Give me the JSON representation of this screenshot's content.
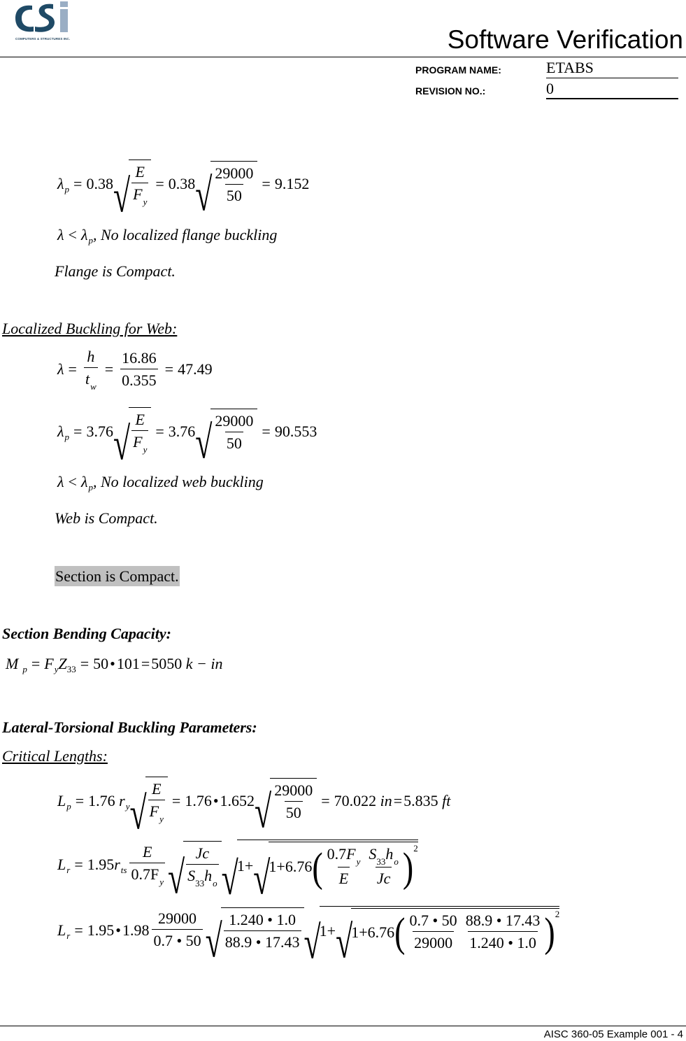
{
  "header": {
    "logo_text": "CSI",
    "logo_subtitle": "COMPUTERS & STRUCTURES INC.",
    "title": "Software Verification",
    "program_name_label": "PROGRAM NAME:",
    "program_name_value": "ETABS",
    "revision_label": "REVISION NO.:",
    "revision_value": "0",
    "colors": {
      "logo_dark": "#1f4a66",
      "logo_light": "#9aaec4"
    }
  },
  "flange": {
    "lambda_p": {
      "lhs": "λ",
      "lhs_sub": "p",
      "coef": "0.38",
      "num_sym": "E",
      "den_sym": "F",
      "den_sub": "y",
      "num_val": "29000",
      "den_val": "50",
      "result": "9.152"
    },
    "check": {
      "text": ", No localized flange buckling"
    },
    "conclusion": "Flange is Compact."
  },
  "web": {
    "heading": "Localized Buckling for Web:",
    "lambda": {
      "lhs": "λ",
      "num_sym": "h",
      "den_sym": "t",
      "den_sub": "w",
      "num_val": "16.86",
      "den_val": "0.355",
      "result": "47.49"
    },
    "lambda_p": {
      "lhs": "λ",
      "lhs_sub": "p",
      "coef": "3.76",
      "num_sym": "E",
      "den_sym": "F",
      "den_sub": "y",
      "num_val": "29000",
      "den_val": "50",
      "result": "90.553"
    },
    "check": {
      "text": ", No localized web buckling"
    },
    "conclusion": "Web is Compact."
  },
  "section_result": "Section is Compact.",
  "bending": {
    "heading": "Section Bending Capacity:",
    "mp": {
      "lhs": "M",
      "lhs_sub": "p",
      "fy": "F",
      "fy_sub": "y",
      "z": "Z",
      "z_sub": "33",
      "fy_val": "50",
      "z_val": "101",
      "result": "5050",
      "units": "k − in"
    }
  },
  "ltb": {
    "heading": "Lateral-Torsional Buckling Parameters:",
    "subheading": "Critical Lengths:",
    "lp": {
      "lhs": "L",
      "lhs_sub": "p",
      "coef": "1.76",
      "r": "r",
      "r_sub": "y",
      "E": "E",
      "F": "F",
      "F_sub": "y",
      "ry_val": "1.652",
      "E_val": "29000",
      "Fy_val": "50",
      "result_in": "70.022",
      "unit_in": "in",
      "result_ft": "5.835",
      "unit_ft": "ft"
    },
    "lr_formula": {
      "lhs": "L",
      "lhs_sub": "r",
      "coef": "1.95",
      "r": "r",
      "r_sub": "ts",
      "E": "E",
      "den1": "0.7F",
      "den1_sub": "y",
      "Jc": "Jc",
      "S": "S",
      "S_sub": "33",
      "h": "h",
      "h_sub": "o",
      "one": "1+",
      "coef2": "6.76",
      "exp": "2"
    },
    "lr_values": {
      "lhs": "L",
      "lhs_sub": "r",
      "coef": "1.95",
      "rts_val": "1.98",
      "E_val": "29000",
      "den1": "0.7 • 50",
      "jc": "1.240 • 1.0",
      "sh": "88.9 • 17.43",
      "one": "1+",
      "coef2": "6.76",
      "frac1_num": "0.7 • 50",
      "frac1_den": "29000",
      "frac2_num": "88.9 • 17.43",
      "frac2_den": "1.240 • 1.0",
      "exp": "2"
    }
  },
  "footer": {
    "text": "AISC 360-05 Example 001 - 4"
  }
}
